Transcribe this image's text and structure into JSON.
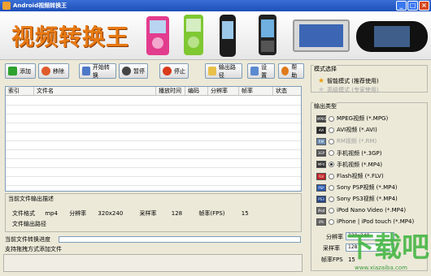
{
  "window": {
    "title": "Android视频转换王",
    "min": "_",
    "max": "□",
    "close": "×"
  },
  "banner": {
    "logo_text": "视频转换王"
  },
  "toolbar": {
    "add": "添加",
    "remove": "移除",
    "start": "开始转换",
    "pause": "暂停",
    "stop": "停止",
    "output_path": "输出路径",
    "settings": "设置",
    "help": "帮助"
  },
  "table": {
    "columns": [
      "索引",
      "文件名",
      "播放时间",
      "编码",
      "分辨率",
      "帧率",
      "状态"
    ]
  },
  "info": {
    "title": "当前文件输出描述",
    "format_label": "文件格式",
    "format_value": "mp4",
    "res_label": "分辨率",
    "res_value": "320x240",
    "rate_label": "采样率",
    "rate_value": "128",
    "fps_label": "帧率(FPS)",
    "fps_value": "15",
    "path_label": "文件输出路径"
  },
  "progress": {
    "label": "当前文件转换进度",
    "percent": 0
  },
  "status": {
    "text": "支持拖拽方式添加文件"
  },
  "mode": {
    "title": "模式选择",
    "options": [
      {
        "label": "智能模式 (推荐使用)",
        "selected": true,
        "enabled": true
      },
      {
        "label": "高级模式 (专家使用)",
        "selected": false,
        "enabled": false
      }
    ]
  },
  "output_type": {
    "title": "输出类型",
    "options": [
      {
        "icon": "mpeg-icon",
        "badge": "MPEG",
        "label": "MPEG视频 (*.MPG)",
        "selected": false,
        "enabled": true
      },
      {
        "icon": "avi-icon",
        "badge": "AVI",
        "label": "AVI视频 (*.AVI)",
        "selected": false,
        "enabled": true
      },
      {
        "icon": "rm-icon",
        "badge": "RM",
        "label": "RM视频 (*.RM)",
        "selected": false,
        "enabled": false
      },
      {
        "icon": "phone-3gp-icon",
        "badge": "3GP",
        "label": "手机视频 (*.3GP)",
        "selected": false,
        "enabled": true
      },
      {
        "icon": "mp4-icon",
        "badge": "MP4",
        "label": "手机视频 (*.MP4)",
        "selected": true,
        "enabled": true
      },
      {
        "icon": "flash-icon",
        "badge": "FLV",
        "label": "Flash视频 (*.FLV)",
        "selected": false,
        "enabled": true
      },
      {
        "icon": "psp-icon",
        "badge": "PSP",
        "label": "Sony PSP视频 (*.MP4)",
        "selected": false,
        "enabled": true
      },
      {
        "icon": "ps3-icon",
        "badge": "PS3",
        "label": "Sony PS3视频 (*.MP4)",
        "selected": false,
        "enabled": true
      },
      {
        "icon": "ipod-nano-icon",
        "badge": "iPod",
        "label": "iPod Nano Video (*.MP4)",
        "selected": false,
        "enabled": true
      },
      {
        "icon": "iphone-icon",
        "badge": "iPh",
        "label": "iPhone | iPod touch (*.MP4)",
        "selected": false,
        "enabled": true
      }
    ]
  },
  "settings": {
    "res_label": "分辨率",
    "res_value": "320x240",
    "rate_label": "采样率",
    "rate_value": "128",
    "fps_label": "帧率FPS",
    "fps_value": "15"
  },
  "colors": {
    "accent": "#e87a14",
    "titlebar": "#1d4fb9"
  }
}
